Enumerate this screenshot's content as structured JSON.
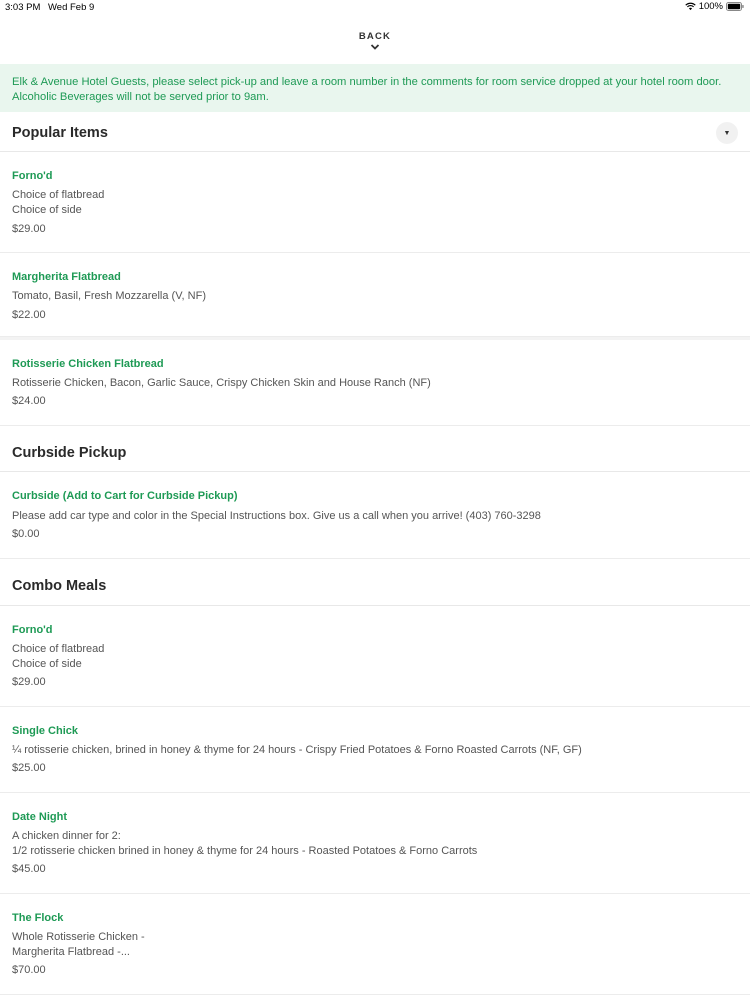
{
  "status_bar": {
    "time": "3:03 PM",
    "date": "Wed Feb 9",
    "battery": "100%"
  },
  "nav": {
    "back_label": "BACK"
  },
  "banner": {
    "line1": "Elk & Avenue Hotel Guests, please select pick-up and leave a room number in the comments for room service dropped at your hotel room door.",
    "line2": "Alcoholic Beverages will not be served prior to 9am."
  },
  "sections": {
    "popular": {
      "title": "Popular Items",
      "items": [
        {
          "name": "Forno'd",
          "desc1": "Choice of flatbread",
          "desc2": "Choice of side",
          "price": "$29.00"
        },
        {
          "name": "Margherita Flatbread",
          "desc1": "Tomato, Basil, Fresh Mozzarella (V, NF)",
          "price": "$22.00"
        },
        {
          "name": "Rotisserie Chicken Flatbread",
          "desc1": "Rotisserie Chicken, Bacon, Garlic Sauce, Crispy Chicken Skin and House Ranch (NF)",
          "price": "$24.00"
        }
      ]
    },
    "curbside": {
      "title": "Curbside Pickup",
      "items": [
        {
          "name": "Curbside (Add to Cart for Curbside Pickup)",
          "desc1": "Please add car type and color in the Special Instructions box. Give us a call when you arrive! (403) 760-3298",
          "price": "$0.00"
        }
      ]
    },
    "combo": {
      "title": "Combo Meals",
      "items": [
        {
          "name": "Forno'd",
          "desc1": "Choice of flatbread",
          "desc2": "Choice of side",
          "price": "$29.00"
        },
        {
          "name": "Single Chick",
          "desc1": "¼ rotisserie chicken, brined in honey & thyme for 24 hours - Crispy Fried Potatoes & Forno Roasted Carrots (NF, GF)",
          "price": "$25.00"
        },
        {
          "name": "Date Night",
          "desc1": "A chicken dinner for 2:",
          "desc2": "1/2 rotisserie chicken brined in honey & thyme for 24 hours -  Roasted Potatoes & Forno Carrots",
          "price": "$45.00"
        },
        {
          "name": "The Flock",
          "desc1": "Whole Rotisserie Chicken -",
          "desc2": "Margherita Flatbread -...",
          "price": "$70.00"
        }
      ]
    }
  },
  "colors": {
    "accent_green": "#1e9a55",
    "banner_bg": "#e9f6ee"
  },
  "icons": {
    "wifi": "wifi-icon",
    "battery": "battery-icon",
    "back_chevron": "chevron-down-icon",
    "collapse": "caret-down-icon"
  }
}
